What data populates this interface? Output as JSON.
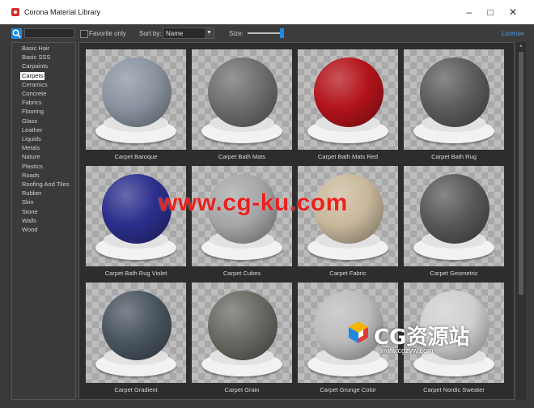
{
  "window": {
    "title": "Corona Material Library",
    "minimize_icon": "minimize-icon",
    "maximize_icon": "maximize-icon",
    "close_icon": "close-icon"
  },
  "toolbar": {
    "search_icon": "search-icon",
    "search_value": "",
    "favorite_label": "Favorite only",
    "favorite_checked": false,
    "sort_label": "Sort by:",
    "sort_value": "Name",
    "size_label": "Size:",
    "size_level": 0.9,
    "license_label": "License"
  },
  "categories": {
    "selected": "Carpets",
    "items": [
      "Basic Hair",
      "Basic SSS",
      "Carpaints",
      "Carpets",
      "Ceramics",
      "Concrete",
      "Fabrics",
      "Flooring",
      "Glass",
      "Leather",
      "Liquids",
      "Metals",
      "Nature",
      "Plastics",
      "Roads",
      "Roofing And Tiles",
      "Rubber",
      "Skin",
      "Stone",
      "Walls",
      "Wood"
    ]
  },
  "materials": [
    {
      "name": "Carpet Baroque",
      "color": "#8a93a0"
    },
    {
      "name": "Carpet Bath Mats",
      "color": "#6e6e6e"
    },
    {
      "name": "Carpet Bath Mats Red",
      "color": "#b3141a"
    },
    {
      "name": "Carpet Bath Rug",
      "color": "#5c5c5c"
    },
    {
      "name": "Carpet Bath Rug Violet",
      "color": "#2c2f8c"
    },
    {
      "name": "Carpet Cubes",
      "color": "#a4a6a8"
    },
    {
      "name": "Carpet Fabric",
      "color": "#c9b89c"
    },
    {
      "name": "Carpet Geometric",
      "color": "#585858"
    },
    {
      "name": "Carpet Gradient",
      "color": "#4a5560"
    },
    {
      "name": "Carpet Grain",
      "color": "#6a6862"
    },
    {
      "name": "Carpet Grunge Color",
      "color": "#bcbcbc"
    },
    {
      "name": "Carpet Nordic Sweater",
      "color": "#cfcfcf"
    }
  ],
  "watermarks": {
    "main": "www.cg-ku.com",
    "logo_text": "CG资源站",
    "logo_url": "www.cgzyw.com"
  }
}
